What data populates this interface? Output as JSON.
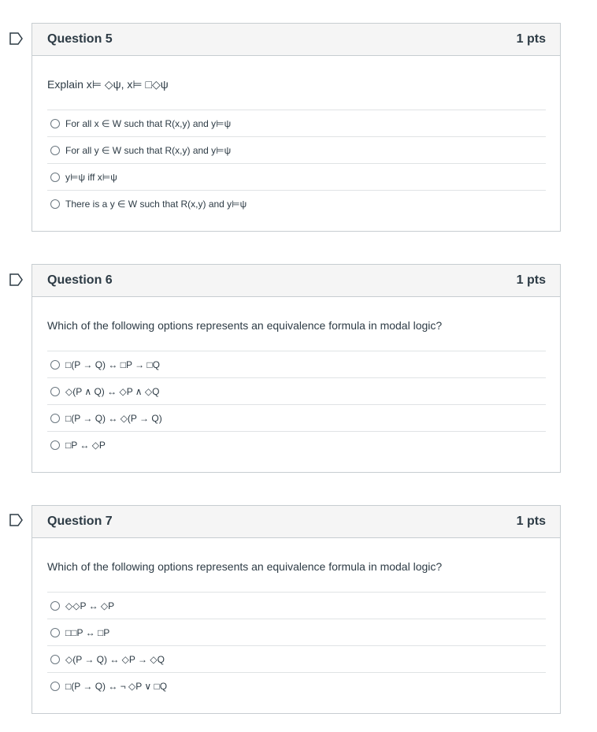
{
  "questions": [
    {
      "title": "Question 5",
      "points": "1 pts",
      "text": "Explain x⊨ ◇ψ, x⊨ □◇ψ",
      "options": [
        "For all x ∈ W such that R(x,y) and y⊨ψ",
        "For all y ∈ W such that R(x,y) and y⊨ψ",
        "y⊨ψ iff x⊨ψ",
        "There is a y ∈ W such that R(x,y) and y⊨ψ"
      ]
    },
    {
      "title": "Question 6",
      "points": "1 pts",
      "text": "Which of the following options represents an equivalence formula in modal logic?",
      "options": [
        "□(P → Q) ↔ □P → □Q",
        "◇(P ∧ Q) ↔ ◇P ∧ ◇Q",
        "□(P → Q) ↔ ◇(P → Q)",
        "□P ↔ ◇P"
      ]
    },
    {
      "title": "Question 7",
      "points": "1 pts",
      "text": "Which of the following options represents an equivalence formula in modal logic?",
      "options": [
        "◇◇P ↔ ◇P",
        "□□P ↔ □P",
        "◇(P → Q) ↔ ◇P → ◇Q",
        "□(P → Q) ↔ ¬ ◇P ∨ □Q"
      ]
    }
  ]
}
